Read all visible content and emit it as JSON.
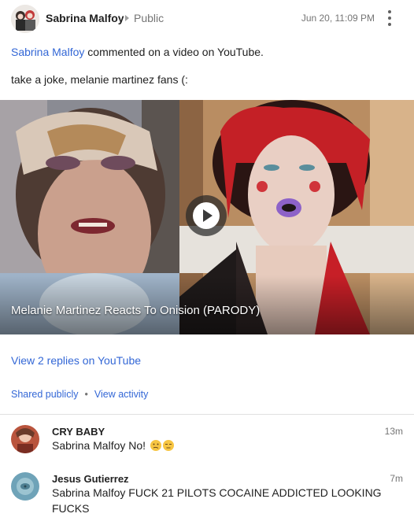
{
  "post": {
    "author": "Sabrina Malfoy",
    "visibility": "Public",
    "timestamp": "Jun 20, 11:09 PM",
    "activity_user": "Sabrina Malfoy",
    "activity_text": "commented on a video on YouTube.",
    "text": "take a joke, melanie martinez fans (:"
  },
  "video": {
    "title": "Melanie Martinez Reacts To Onision (PARODY)"
  },
  "links": {
    "replies": "View 2 replies on YouTube",
    "shared": "Shared publicly",
    "separator": "•",
    "activity": "View activity"
  },
  "comments": [
    {
      "author": "CRY BABY",
      "time": "13m",
      "mention": "Sabrina Malfoy",
      "text": "No!"
    },
    {
      "author": "Jesus Gutierrez",
      "time": "7m",
      "mention": "Sabrina Malfoy",
      "text": "FUCK 21 PILOTS COCAINE ADDICTED LOOKING FUCKS"
    }
  ],
  "colors": {
    "link": "#3367d6",
    "muted": "#757575",
    "text": "#212121"
  },
  "icons": [
    "avatar",
    "caret-right-icon",
    "more-vert-icon",
    "play-icon",
    "confused-face-emoji",
    "expressionless-face-emoji"
  ]
}
